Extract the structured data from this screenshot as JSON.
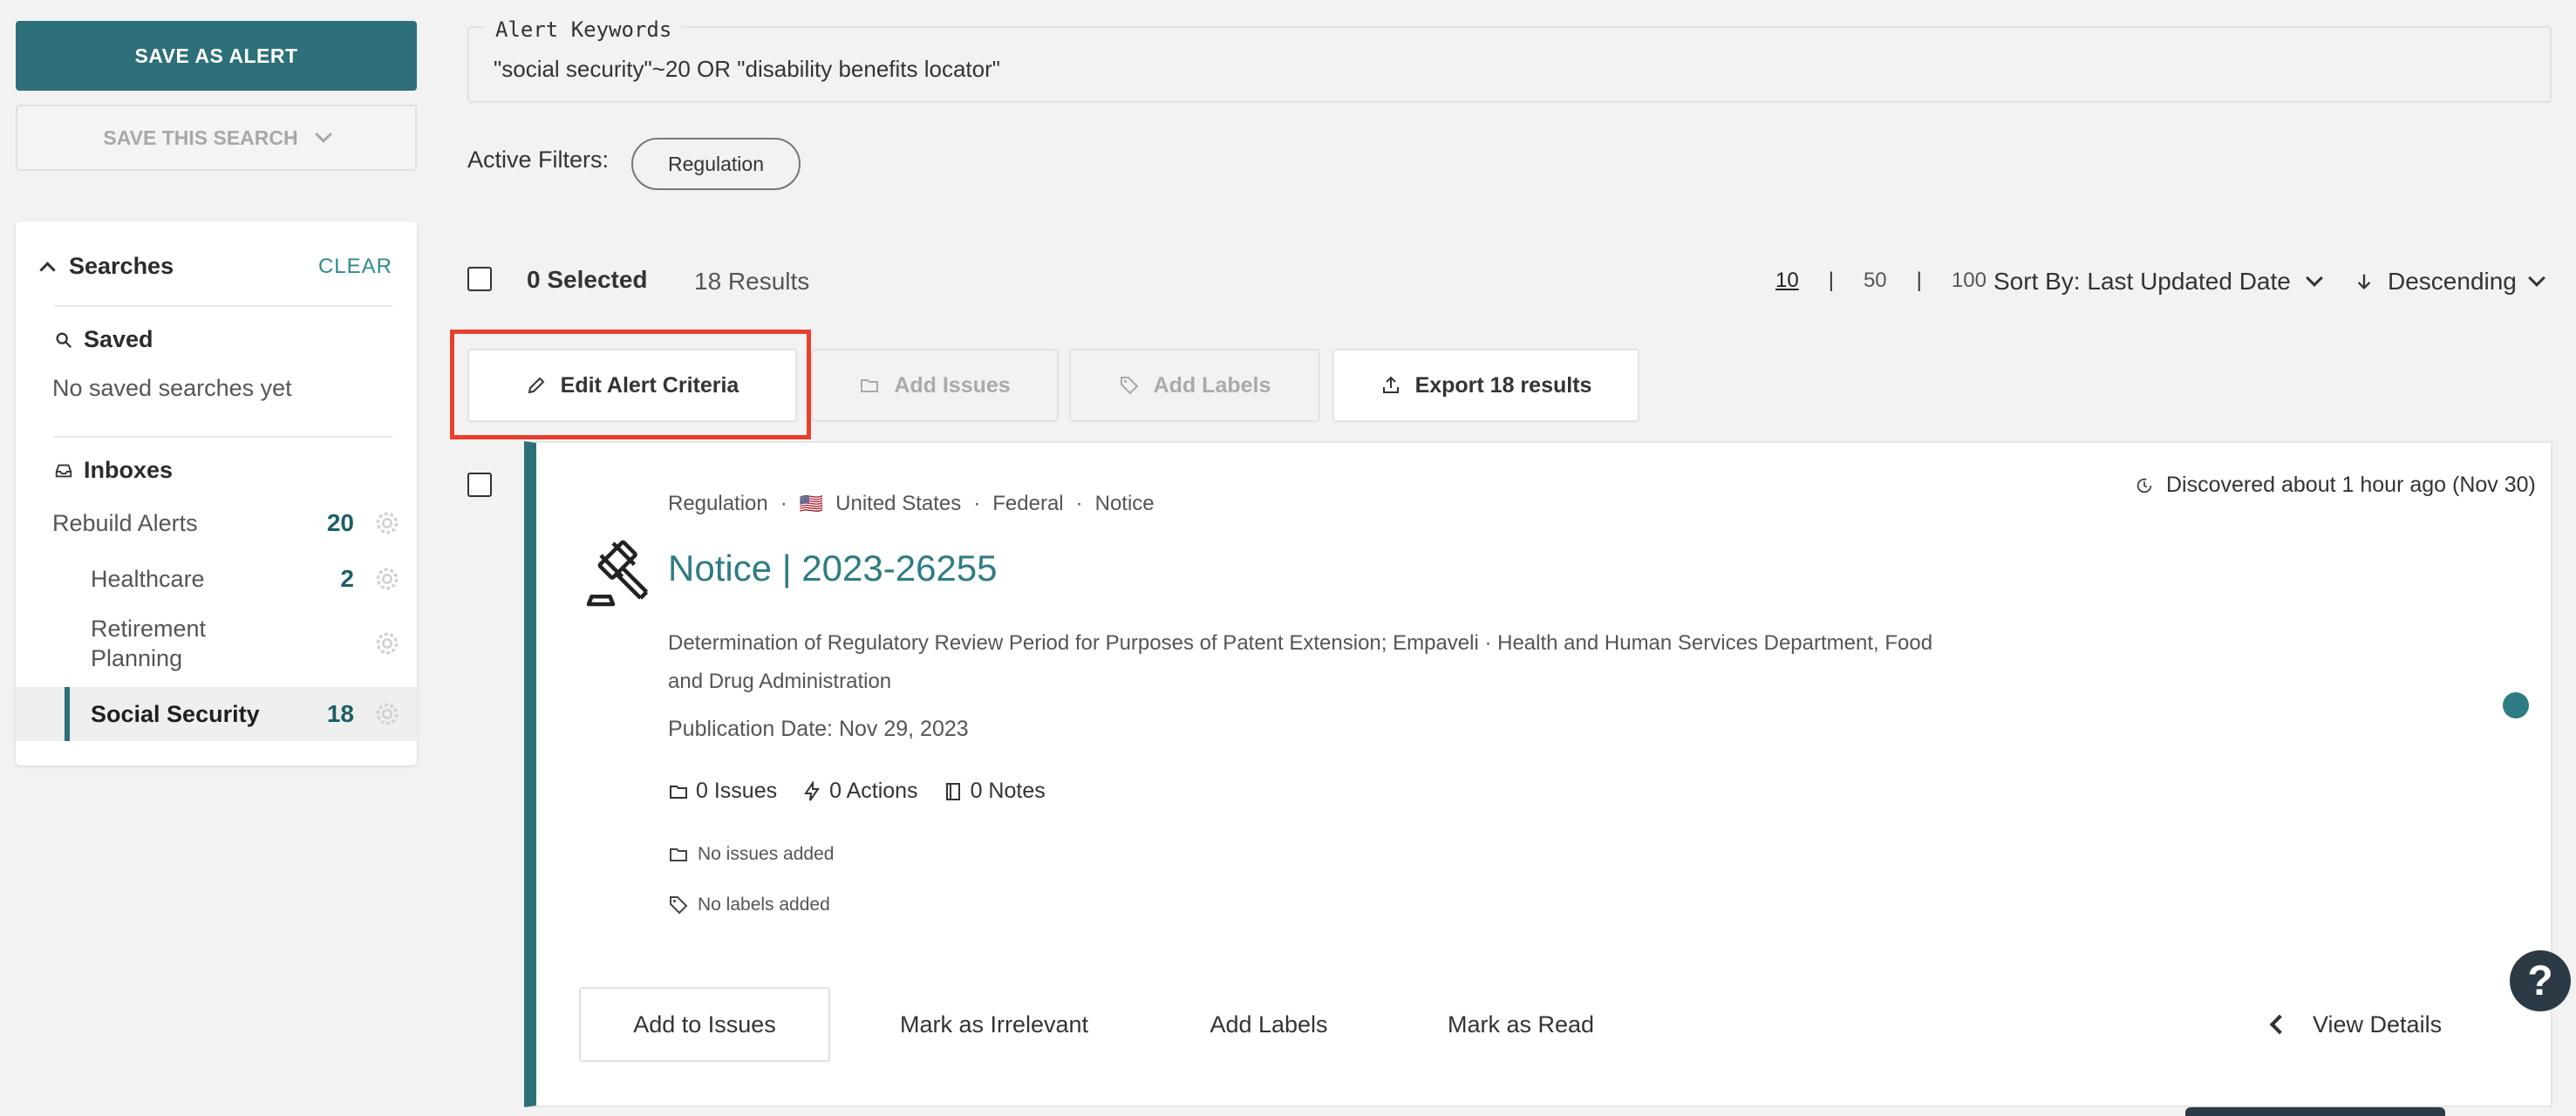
{
  "sidebar": {
    "save_alert_label": "SAVE AS ALERT",
    "save_search_label": "SAVE THIS SEARCH",
    "searches": {
      "title": "Searches",
      "clear_label": "CLEAR",
      "saved_title": "Saved",
      "saved_empty": "No saved searches yet",
      "inboxes_title": "Inboxes",
      "items": [
        {
          "label": "Rebuild Alerts",
          "count": "20"
        },
        {
          "label": "Healthcare",
          "count": "2"
        },
        {
          "label": "Retirement Planning",
          "count": ""
        },
        {
          "label": "Social Security",
          "count": "18"
        }
      ]
    }
  },
  "keywords": {
    "legend": "Alert Keywords",
    "value": "\"social security\"~20 OR \"disability benefits locator\""
  },
  "filters": {
    "label": "Active Filters:",
    "chips": [
      "Regulation"
    ]
  },
  "results_bar": {
    "selected": "0 Selected",
    "results": "18 Results",
    "page_sizes": [
      "10",
      "50",
      "100"
    ],
    "separator": "|",
    "current_page_size": "10",
    "sort_label": "Sort By: Last Updated Date",
    "order_label": "Descending"
  },
  "actions": {
    "edit_alert": "Edit Alert Criteria",
    "add_issues": "Add Issues",
    "add_labels": "Add Labels",
    "export": "Export 18 results"
  },
  "card": {
    "meta": {
      "type": "Regulation",
      "flag": "🇺🇸",
      "country": "United States",
      "level": "Federal",
      "doc_type": "Notice",
      "separator": "·"
    },
    "discovered": "Discovered about 1 hour ago (Nov 30)",
    "title": "Notice | 2023-26255",
    "description": "Determination of Regulatory Review Period for Purposes of Patent Extension; Empaveli  ·  Health and Human Services Department, Food and Drug Administration",
    "publication_date": "Publication Date: Nov 29, 2023",
    "counts": {
      "issues": "0 Issues",
      "actions": "0 Actions",
      "notes": "0 Notes"
    },
    "no_issues": "No issues added",
    "no_labels": "No labels added",
    "buttons": {
      "add_to_issues": "Add to Issues",
      "mark_irrelevant": "Mark as Irrelevant",
      "add_labels": "Add Labels",
      "mark_read": "Mark as Read",
      "view_details": "View Details"
    }
  },
  "help_label": "?",
  "colors": {
    "brand": "#2e7079",
    "link": "#2e7c84",
    "highlight": "#e8402e",
    "background": "#f2f2f2"
  }
}
